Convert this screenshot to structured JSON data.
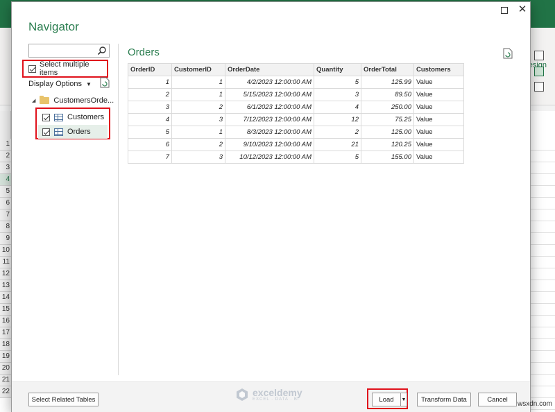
{
  "background": {
    "ribbon_tab": "esign",
    "row_numbers": [
      "1",
      "2",
      "3",
      "4",
      "5",
      "6",
      "7",
      "8",
      "9",
      "10",
      "11",
      "12",
      "13",
      "14",
      "15",
      "16",
      "17",
      "18",
      "19",
      "20",
      "21",
      "22"
    ]
  },
  "dialog": {
    "title": "Navigator",
    "search": {
      "value": "",
      "placeholder": ""
    },
    "select_multiple_label": "Select multiple items",
    "display_options_label": "Display Options",
    "tree": {
      "root": "CustomersOrde...",
      "items": [
        {
          "label": "Customers",
          "checked": true
        },
        {
          "label": "Orders",
          "checked": true,
          "selected": true
        }
      ]
    },
    "preview": {
      "title": "Orders",
      "columns": [
        "OrderID",
        "CustomerID",
        "OrderDate",
        "Quantity",
        "OrderTotal",
        "Customers"
      ],
      "rows": [
        [
          "1",
          "1",
          "4/2/2023 12:00:00 AM",
          "5",
          "125.99",
          "Value"
        ],
        [
          "2",
          "1",
          "5/15/2023 12:00:00 AM",
          "3",
          "89.50",
          "Value"
        ],
        [
          "3",
          "2",
          "6/1/2023 12:00:00 AM",
          "4",
          "250.00",
          "Value"
        ],
        [
          "4",
          "3",
          "7/12/2023 12:00:00 AM",
          "12",
          "75.25",
          "Value"
        ],
        [
          "5",
          "1",
          "8/3/2023 12:00:00 AM",
          "2",
          "125.00",
          "Value"
        ],
        [
          "6",
          "2",
          "9/10/2023 12:00:00 AM",
          "21",
          "120.25",
          "Value"
        ],
        [
          "7",
          "3",
          "10/12/2023 12:00:00 AM",
          "5",
          "155.00",
          "Value"
        ]
      ]
    },
    "footer": {
      "related_tables": "Select Related Tables",
      "load": "Load",
      "transform": "Transform Data",
      "cancel": "Cancel",
      "watermark_name": "exceldemy",
      "watermark_tag": "EXCEL · DATA · BI"
    }
  },
  "site_label": "wsxdn.com",
  "colors": {
    "accent_green": "#2a7d4f",
    "highlight_red": "#e0111b",
    "excel_green": "#217346"
  }
}
